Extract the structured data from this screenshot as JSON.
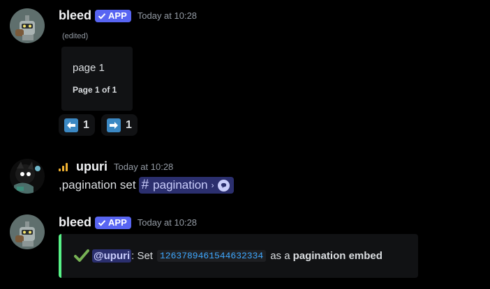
{
  "messages": [
    {
      "author": "bleed",
      "badge": "APP",
      "timestamp": "Today at 10:28",
      "edited": "(edited)",
      "embed": {
        "description": "page 1",
        "footer": "Page 1 of 1"
      },
      "reactions": [
        {
          "emoji": "left-arrow",
          "count": "1"
        },
        {
          "emoji": "right-arrow",
          "count": "1"
        }
      ]
    },
    {
      "author": "upuri",
      "timestamp": "Today at 10:28",
      "content_prefix": ",pagination set",
      "channel": "pagination"
    },
    {
      "author": "bleed",
      "badge": "APP",
      "timestamp": "Today at 10:28",
      "result": {
        "mention": "@upuri",
        "text_set": ": Set",
        "message_id": "1263789461544632334",
        "text_as": "as a",
        "text_bold": "pagination embed"
      }
    }
  ],
  "colors": {
    "accent": "#5865f2",
    "success": "#57f287",
    "background": "#000000"
  },
  "icons": [
    "verified-check-icon",
    "left-arrow-icon",
    "right-arrow-icon",
    "signal-icon",
    "hash-icon",
    "thread-icon",
    "check-icon"
  ]
}
